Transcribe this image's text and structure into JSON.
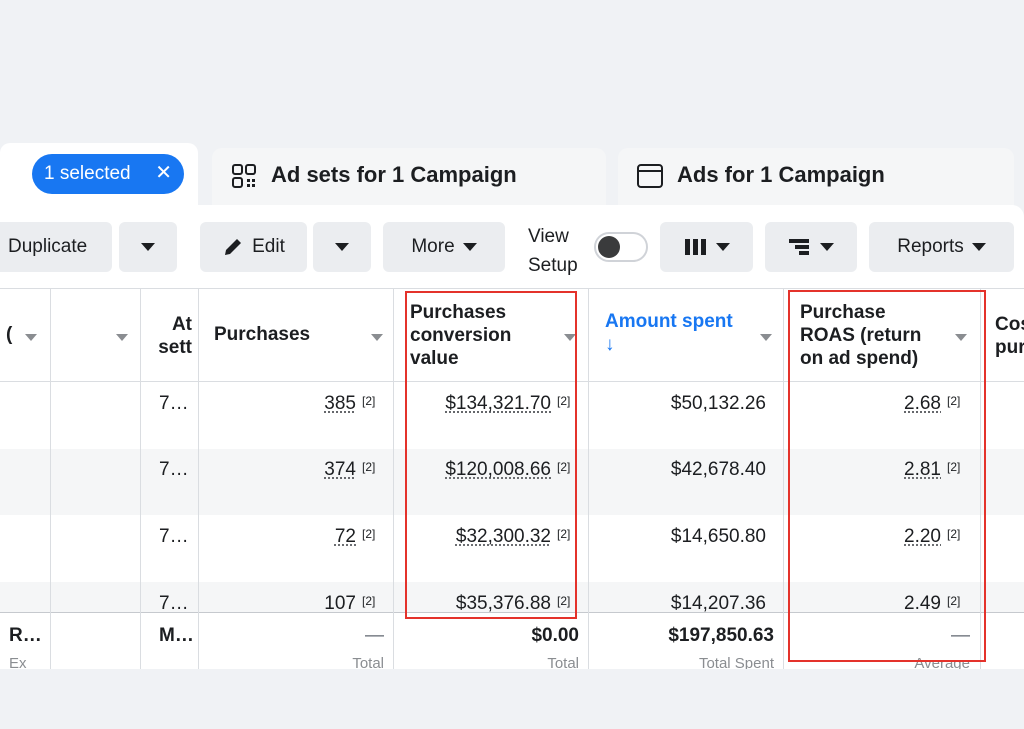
{
  "tabs": {
    "campaigns": {
      "chip_label": "1 selected",
      "chip_close": "✕"
    },
    "adsets": {
      "label": "Ad sets for 1 Campaign",
      "icon": "grid-icon"
    },
    "ads": {
      "label": "Ads for 1 Campaign",
      "icon": "window-icon"
    }
  },
  "toolbar": {
    "duplicate_label": "Duplicate",
    "edit_label": "Edit",
    "more_label": "More",
    "view_setup_line1": "View",
    "view_setup_line2": "Setup",
    "reports_label": "Reports"
  },
  "table": {
    "headers": {
      "col_partial": "(",
      "attribution_l1": "At",
      "attribution_l2": "sett",
      "purchases": "Purchases",
      "conv_value_l1": "Purchases",
      "conv_value_l2": "conversion",
      "conv_value_l3": "value",
      "amount_spent": "Amount spent",
      "amount_spent_sort": "↓",
      "roas_l1": "Purchase",
      "roas_l2": "ROAS (return",
      "roas_l3": "on ad spend)",
      "cost_l1": "Cos",
      "cost_l2": "pur"
    },
    "footnote": "[2]",
    "rows": [
      {
        "attribution": "7…",
        "purchases": "385",
        "conv_value": "$134,321.70",
        "spent": "$50,132.26",
        "roas": "2.68"
      },
      {
        "attribution": "7…",
        "purchases": "374",
        "conv_value": "$120,008.66",
        "spent": "$42,678.40",
        "roas": "2.81"
      },
      {
        "attribution": "7…",
        "purchases": "72",
        "conv_value": "$32,300.32",
        "spent": "$14,650.80",
        "roas": "2.20"
      },
      {
        "attribution": "7…",
        "purchases": "107",
        "conv_value": "$35,376.88",
        "spent": "$14,207.36",
        "roas": "2.49"
      }
    ],
    "totals": {
      "first": "R…",
      "first_sub": "Ex",
      "attribution": "M…",
      "purchases": "—",
      "purchases_sub": "Total",
      "conv_value": "$0.00",
      "conv_value_sub": "Total",
      "spent": "$197,850.63",
      "spent_sub": "Total Spent",
      "roas": "—",
      "roas_sub": "Average"
    }
  },
  "colors": {
    "accent": "#1877f2",
    "highlight": "#e4322b"
  }
}
